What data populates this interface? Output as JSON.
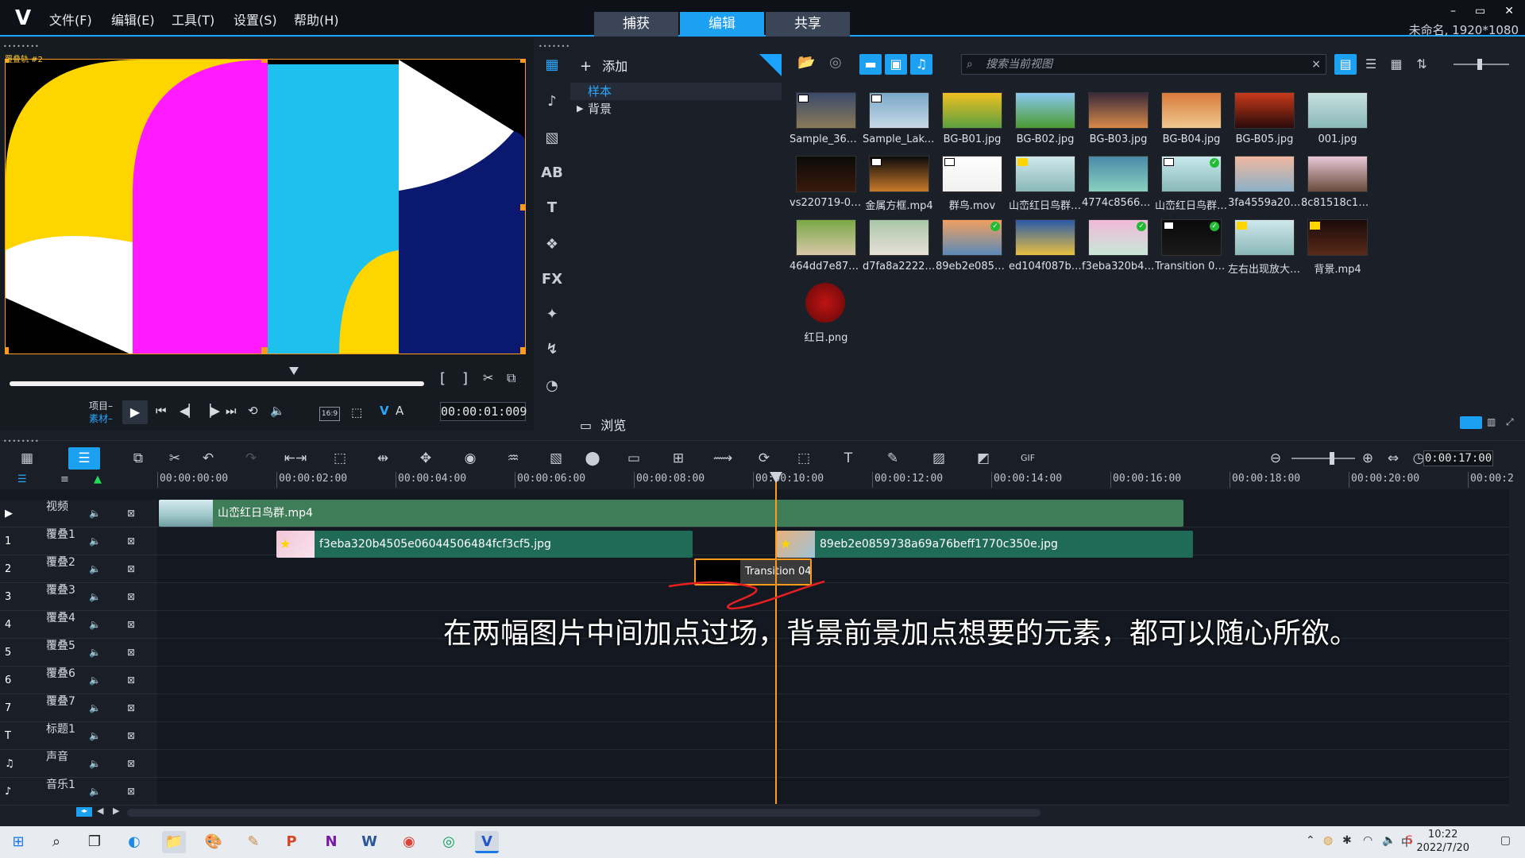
{
  "titlebar": {
    "logo": "V",
    "menus": [
      "文件(F)",
      "编辑(E)",
      "工具(T)",
      "设置(S)",
      "帮助(H)"
    ],
    "tabs": [
      "捕获",
      "编辑",
      "共享"
    ],
    "active_tab": "编辑",
    "window_controls": [
      "–",
      "▭",
      "✕"
    ],
    "project_info": "未命名, 1920*1080"
  },
  "preview": {
    "canvas_label": "覆叠轨 #2",
    "mode_labels": [
      "项目–",
      "素材–"
    ],
    "aspect": "16:9",
    "va_labels": [
      "V",
      "A"
    ],
    "timecode": "00:00:01:009",
    "trim_brackets": [
      "[",
      "]"
    ]
  },
  "library_tools": [
    "▦",
    "♪",
    "▧",
    "AB",
    "T",
    "❖",
    "FX",
    "✦",
    "↯",
    "◔"
  ],
  "folder_panel": {
    "add_label": "添加",
    "items": [
      {
        "label": "样本",
        "selected": true
      },
      {
        "label": "背景",
        "selected": false
      }
    ],
    "browse_label": "浏览"
  },
  "media": {
    "search_placeholder": "搜索当前视图",
    "items": [
      {
        "label": "Sample_360.mp4",
        "badge": "film",
        "check": false
      },
      {
        "label": "Sample_Lake.mp4",
        "badge": "film",
        "check": false
      },
      {
        "label": "BG-B01.jpg",
        "badge": "",
        "check": false
      },
      {
        "label": "BG-B02.jpg",
        "badge": "",
        "check": false
      },
      {
        "label": "BG-B03.jpg",
        "badge": "",
        "check": false
      },
      {
        "label": "BG-B04.jpg",
        "badge": "",
        "check": false
      },
      {
        "label": "BG-B05.jpg",
        "badge": "",
        "check": false
      },
      {
        "label": "001.jpg",
        "badge": "",
        "check": false
      },
      {
        "label": "vs220719-002.png",
        "badge": "",
        "check": false
      },
      {
        "label": "金属方框.mp4",
        "badge": "film",
        "check": false
      },
      {
        "label": "群鸟.mov",
        "badge": "film",
        "check": false
      },
      {
        "label": "山峦红日鸟群.m...",
        "badge": "star",
        "check": false
      },
      {
        "label": "4774c856608098f...",
        "badge": "",
        "check": false
      },
      {
        "label": "山峦红日鸟群.m...",
        "badge": "film",
        "check": true
      },
      {
        "label": "3fa4559a20082c1...",
        "badge": "",
        "check": false
      },
      {
        "label": "8c81518c10e9eb...",
        "badge": "",
        "check": false
      },
      {
        "label": "464dd7e872bc69...",
        "badge": "",
        "check": false
      },
      {
        "label": "d7fa8a2222826d...",
        "badge": "",
        "check": false
      },
      {
        "label": "89eb2e0859738a...",
        "badge": "",
        "check": true
      },
      {
        "label": "ed104f087b8fd0f...",
        "badge": "",
        "check": false
      },
      {
        "label": "f3eba320b4505e...",
        "badge": "",
        "check": true
      },
      {
        "label": "Transition 04.mp4",
        "badge": "film",
        "check": true
      },
      {
        "label": "左右出现放大的...",
        "badge": "star",
        "check": false
      },
      {
        "label": "背景.mp4",
        "badge": "star",
        "check": false
      },
      {
        "label": "红日.png",
        "badge": "",
        "check": false
      }
    ]
  },
  "timeline": {
    "timecode": "0:00:17:00",
    "ruler": [
      "00:00:00:00",
      "00:00:02:00",
      "00:00:04:00",
      "00:00:06:00",
      "00:00:08:00",
      "00:00:10:00",
      "00:00:12:00",
      "00:00:14:00",
      "00:00:16:00",
      "00:00:18:00",
      "00:00:20:00",
      "00:00:2"
    ],
    "tracks": [
      {
        "name": "视频",
        "icon": "▶"
      },
      {
        "name": "覆叠1",
        "icon": "1"
      },
      {
        "name": "覆叠2",
        "icon": "2"
      },
      {
        "name": "覆叠3",
        "icon": "3"
      },
      {
        "name": "覆叠4",
        "icon": "4"
      },
      {
        "name": "覆叠5",
        "icon": "5"
      },
      {
        "name": "覆叠6",
        "icon": "6"
      },
      {
        "name": "覆叠7",
        "icon": "7"
      },
      {
        "name": "标题1",
        "icon": "T"
      },
      {
        "name": "声音",
        "icon": "♫"
      },
      {
        "name": "音乐1",
        "icon": "♪"
      }
    ],
    "clips": {
      "video": "山峦红日鸟群.mp4",
      "overlay1_a": "f3eba320b4505e06044506484fcf3cf5.jpg",
      "overlay1_b": "89eb2e0859738a69a76beff1770c350e.jpg",
      "overlay2": "Transition 04"
    }
  },
  "annotation": "在两幅图片中间加点过场，背景前景加点想要的元素，都可以随心所欲。",
  "taskbar": {
    "time": "10:22",
    "date": "2022/7/20"
  }
}
